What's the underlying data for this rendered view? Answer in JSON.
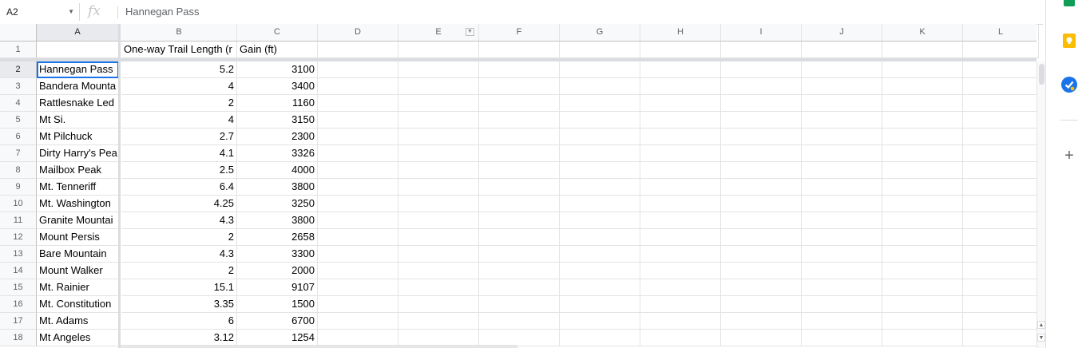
{
  "formula_bar": {
    "cell_ref": "A2",
    "fx_label": "fx",
    "content": "Hannegan Pass"
  },
  "columns": [
    "A",
    "B",
    "C",
    "D",
    "E",
    "F",
    "G",
    "H",
    "I",
    "J",
    "K",
    "L"
  ],
  "row_numbers": [
    "1",
    "2",
    "3",
    "4",
    "5",
    "6",
    "7",
    "8",
    "9",
    "10",
    "11",
    "12",
    "13",
    "14",
    "15",
    "16",
    "17",
    "18"
  ],
  "header_row": [
    "",
    "One-way Trail Length (r",
    "Gain (ft)"
  ],
  "rows": [
    [
      "Hannegan Pass",
      "5.2",
      "3100"
    ],
    [
      "Bandera Mounta",
      "4",
      "3400"
    ],
    [
      "Rattlesnake Led",
      "2",
      "1160"
    ],
    [
      "Mt Si.",
      "4",
      "3150"
    ],
    [
      "Mt Pilchuck",
      "2.7",
      "2300"
    ],
    [
      "Dirty Harry's Pea",
      "4.1",
      "3326"
    ],
    [
      "Mailbox Peak",
      "2.5",
      "4000"
    ],
    [
      "Mt. Tenneriff",
      "6.4",
      "3800"
    ],
    [
      "Mt. Washington",
      "4.25",
      "3250"
    ],
    [
      "Granite Mountai",
      "4.3",
      "3800"
    ],
    [
      "Mount Persis",
      "2",
      "2658"
    ],
    [
      "Bare Mountain",
      "4.3",
      "3300"
    ],
    [
      "Mount Walker",
      "2",
      "2000"
    ],
    [
      "Mt. Rainier",
      "15.1",
      "9107"
    ],
    [
      "Mt. Constitution",
      "3.35",
      "1500"
    ],
    [
      "Mt. Adams",
      "6",
      "6700"
    ],
    [
      "Mt Angeles",
      "3.12",
      "1254"
    ]
  ],
  "side_panel": {
    "icons": [
      "sheets-icon",
      "keep-icon",
      "tasks-icon",
      "add-icon"
    ]
  },
  "colors": {
    "selection": "#1a73e8",
    "header_bg": "#f8f9fa",
    "gridline": "#e2e3e3"
  }
}
